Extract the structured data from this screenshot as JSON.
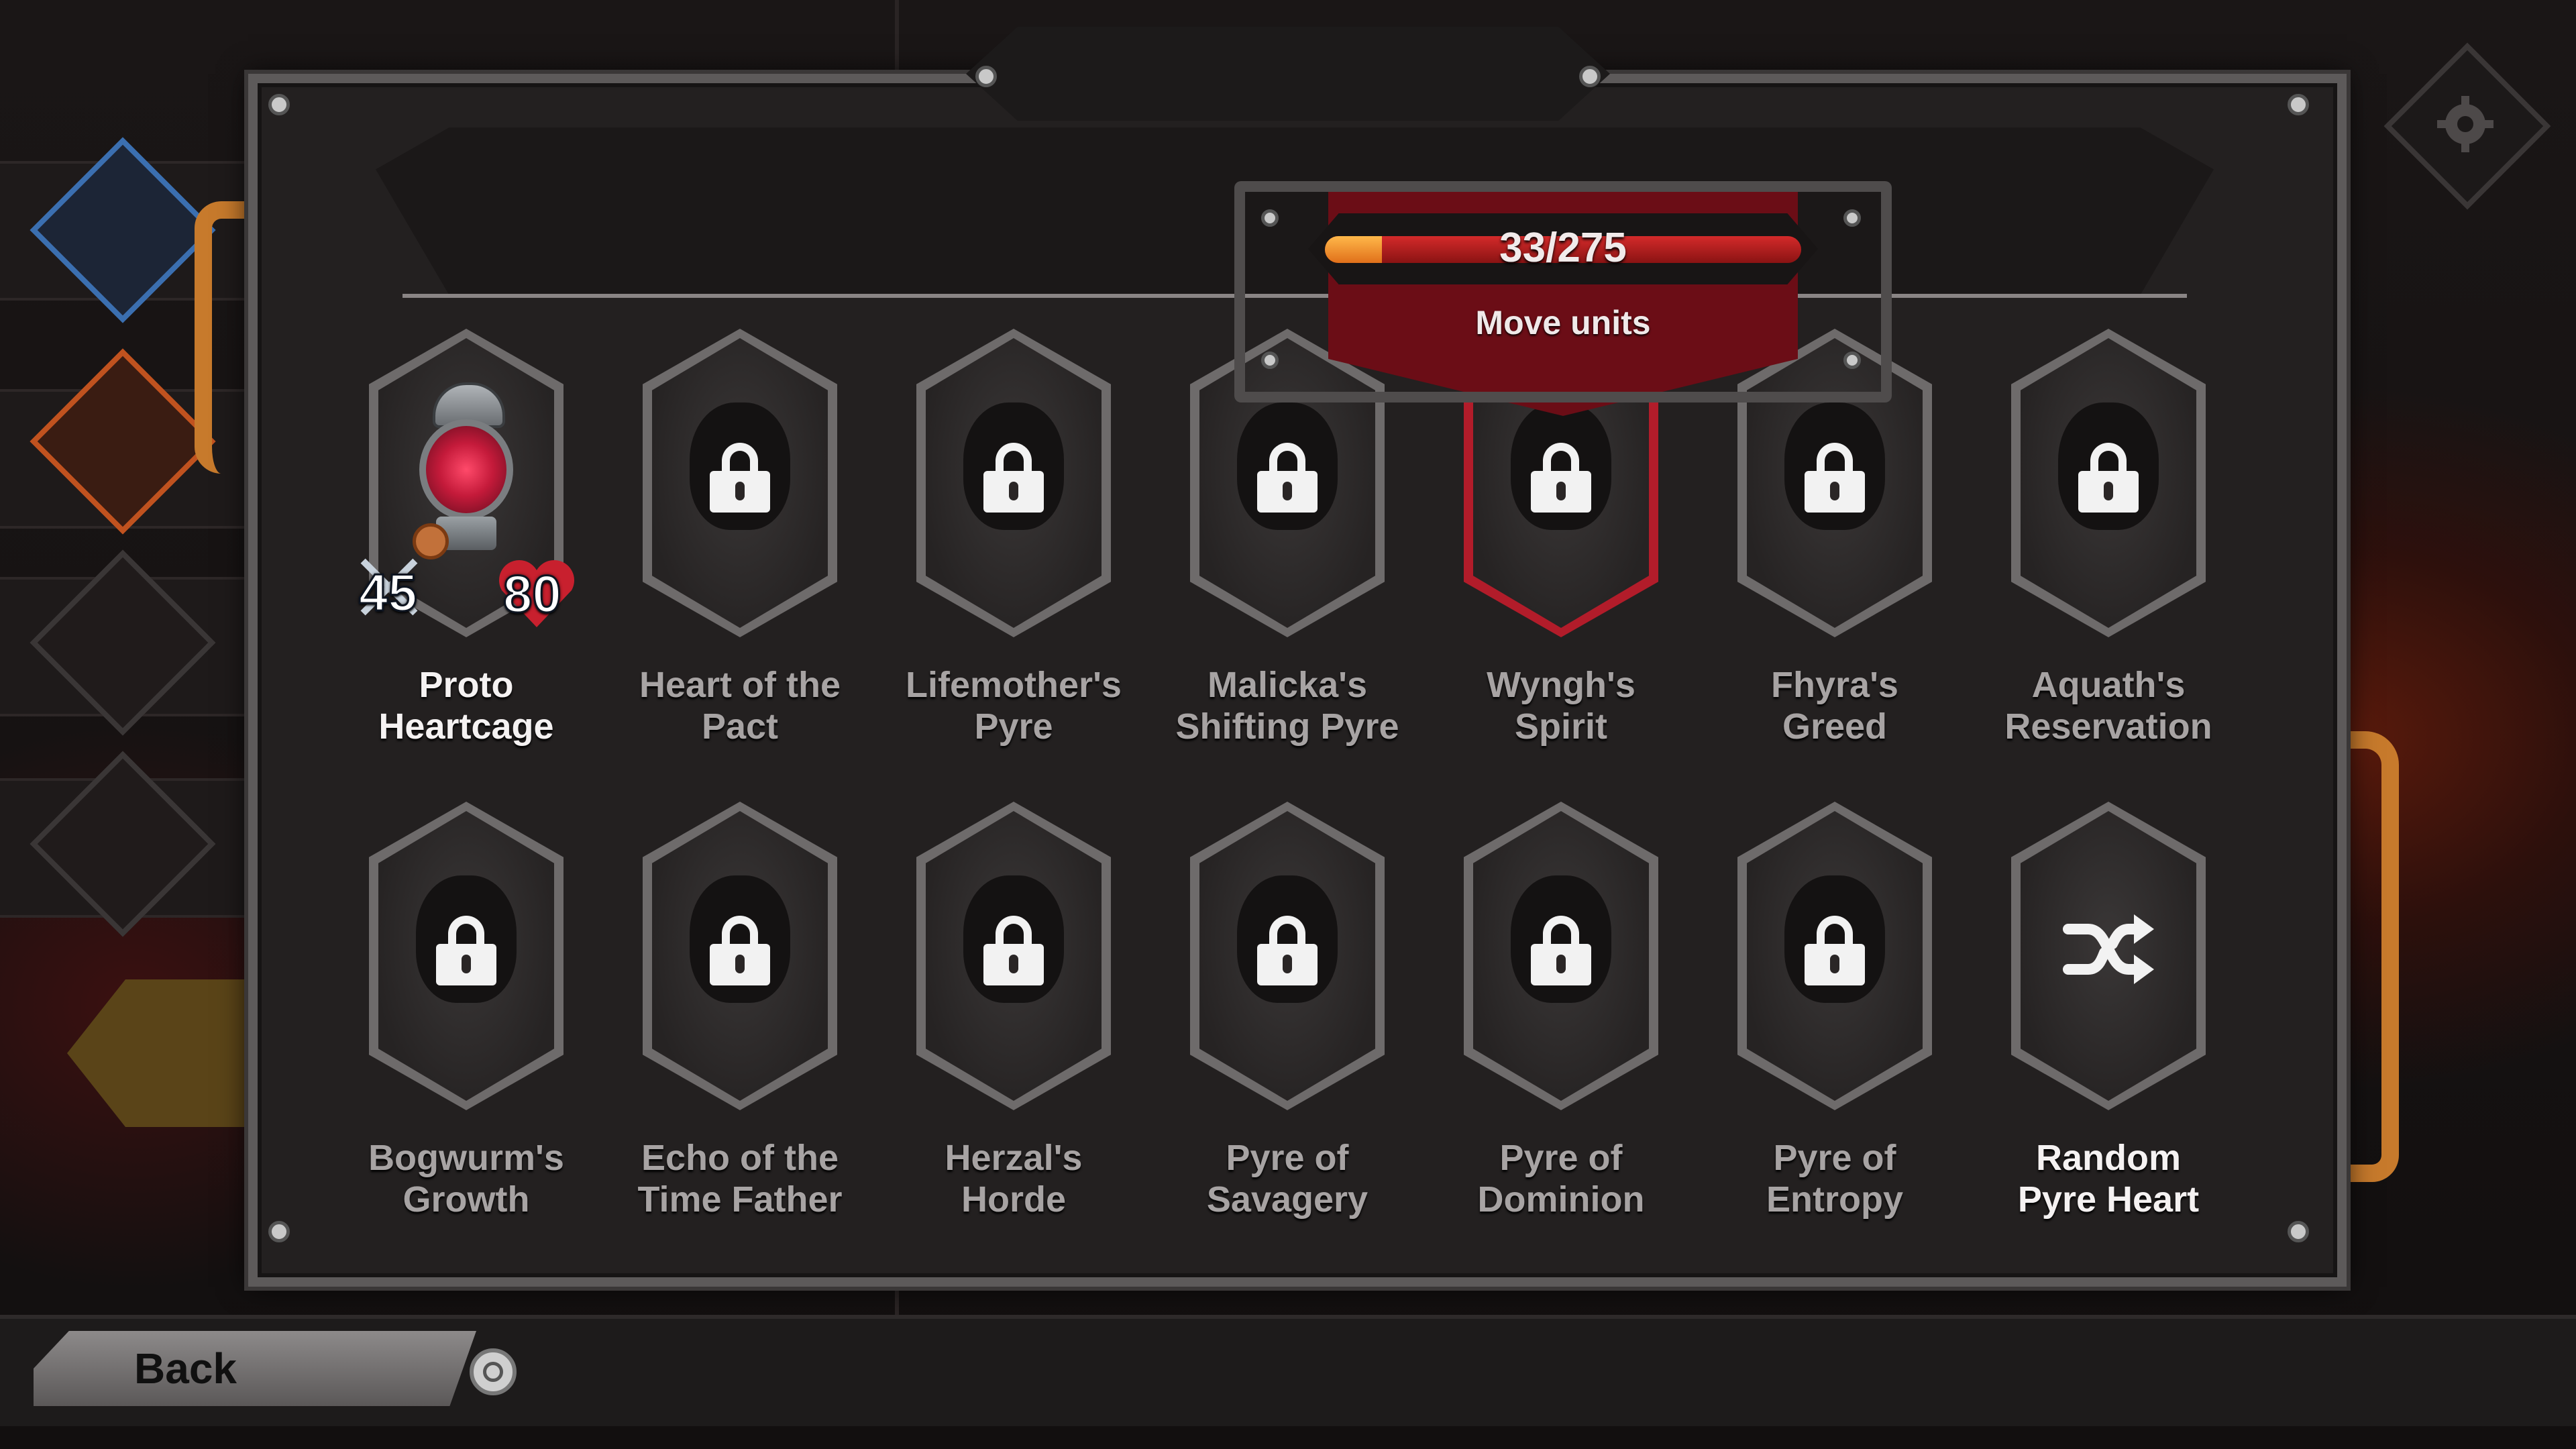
{
  "tooltip": {
    "progress_text": "33/275",
    "progress_value": 33,
    "progress_max": 275,
    "label": "Move units"
  },
  "row1": [
    {
      "label_l1": "Proto",
      "label_l2": "Heartcage",
      "locked": false,
      "attack": "45",
      "health": "80"
    },
    {
      "label_l1": "Heart of the",
      "label_l2": "Pact",
      "locked": true
    },
    {
      "label_l1": "Lifemother's",
      "label_l2": "Pyre",
      "locked": true
    },
    {
      "label_l1": "Malicka's",
      "label_l2": "Shifting Pyre",
      "locked": true
    },
    {
      "label_l1": "Wyngh's",
      "label_l2": "Spirit",
      "locked": true,
      "selected": true
    },
    {
      "label_l1": "Fhyra's",
      "label_l2": "Greed",
      "locked": true
    },
    {
      "label_l1": "Aquath's",
      "label_l2": "Reservation",
      "locked": true
    }
  ],
  "row2": [
    {
      "label_l1": "Bogwurm's",
      "label_l2": "Growth",
      "locked": true
    },
    {
      "label_l1": "Echo of the",
      "label_l2": "Time Father",
      "locked": true
    },
    {
      "label_l1": "Herzal's",
      "label_l2": "Horde",
      "locked": true
    },
    {
      "label_l1": "Pyre of",
      "label_l2": "Savagery",
      "locked": true
    },
    {
      "label_l1": "Pyre of",
      "label_l2": "Dominion",
      "locked": true
    },
    {
      "label_l1": "Pyre of",
      "label_l2": "Entropy",
      "locked": true
    },
    {
      "label_l1": "Random",
      "label_l2": "Pyre Heart",
      "locked": false,
      "icon": "shuffle-icon"
    }
  ],
  "bottom": {
    "back_label": "Back",
    "confirm_icon": "circle-button-icon"
  },
  "colors": {
    "accent_red": "#b21c2a",
    "progress_orange": "#f09a36",
    "pipe_copper": "#c77a2c"
  }
}
